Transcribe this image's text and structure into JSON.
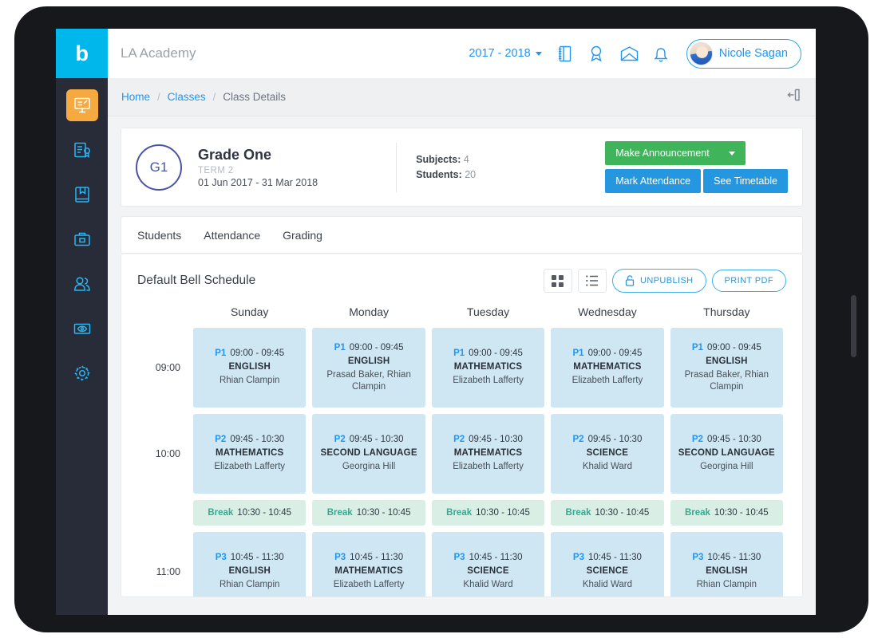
{
  "topbar": {
    "logo_letter": "b",
    "brand": "LA Academy",
    "year": "2017 - 2018",
    "icons": [
      "notebook-icon",
      "award-icon",
      "envelope-icon",
      "bell-icon"
    ],
    "user_name": "Nicole Sagan"
  },
  "sidebar": {
    "items": [
      {
        "icon": "whiteboard-icon",
        "active": true
      },
      {
        "icon": "certificate-icon",
        "active": false
      },
      {
        "icon": "book-icon",
        "active": false
      },
      {
        "icon": "briefcase-icon",
        "active": false
      },
      {
        "icon": "people-icon",
        "active": false
      },
      {
        "icon": "payment-icon",
        "active": false
      },
      {
        "icon": "gear-icon",
        "active": false
      }
    ]
  },
  "breadcrumb": {
    "home": "Home",
    "classes": "Classes",
    "current": "Class Details",
    "sep": "/",
    "logout_icon": "logout-icon"
  },
  "class_card": {
    "badge": "G1",
    "title": "Grade One",
    "term": "TERM 2",
    "dates": "01 Jun 2017 - 31 Mar 2018",
    "subjects_label": "Subjects:",
    "subjects_value": "4",
    "students_label": "Students:",
    "students_value": "20",
    "announce_button": "Make Announcement",
    "attendance_button": "Mark Attendance",
    "timetable_button": "See Timetable",
    "green": "#3fb45a",
    "blue": "#2596e0"
  },
  "tabs": [
    {
      "label": "Students"
    },
    {
      "label": "Attendance"
    },
    {
      "label": "Grading"
    }
  ],
  "schedule": {
    "title": "Default Bell Schedule",
    "grid_view_icon": "grid-view-icon",
    "list_view_icon": "list-view-icon",
    "unpublish_button": "UNPUBLISH",
    "unpublish_icon": "unlock-icon",
    "print_button": "PRINT PDF",
    "days": [
      "Sunday",
      "Monday",
      "Tuesday",
      "Wednesday",
      "Thursday"
    ],
    "time_labels": [
      "09:00",
      "10:00",
      "",
      "11:00"
    ],
    "rows": [
      {
        "type": "period",
        "slots": [
          {
            "period": "P1",
            "time": "09:00 - 09:45",
            "subject": "ENGLISH",
            "teachers": "Rhian Clampin"
          },
          {
            "period": "P1",
            "time": "09:00 - 09:45",
            "subject": "ENGLISH",
            "teachers": "Prasad Baker, Rhian Clampin"
          },
          {
            "period": "P1",
            "time": "09:00 - 09:45",
            "subject": "MATHEMATICS",
            "teachers": "Elizabeth Lafferty"
          },
          {
            "period": "P1",
            "time": "09:00 - 09:45",
            "subject": "MATHEMATICS",
            "teachers": "Elizabeth Lafferty"
          },
          {
            "period": "P1",
            "time": "09:00 - 09:45",
            "subject": "ENGLISH",
            "teachers": "Prasad Baker, Rhian Clampin"
          }
        ]
      },
      {
        "type": "period",
        "slots": [
          {
            "period": "P2",
            "time": "09:45 - 10:30",
            "subject": "MATHEMATICS",
            "teachers": "Elizabeth Lafferty"
          },
          {
            "period": "P2",
            "time": "09:45 - 10:30",
            "subject": "SECOND LANGUAGE",
            "teachers": "Georgina Hill"
          },
          {
            "period": "P2",
            "time": "09:45 - 10:30",
            "subject": "MATHEMATICS",
            "teachers": "Elizabeth Lafferty"
          },
          {
            "period": "P2",
            "time": "09:45 - 10:30",
            "subject": "SCIENCE",
            "teachers": "Khalid Ward"
          },
          {
            "period": "P2",
            "time": "09:45 - 10:30",
            "subject": "SECOND LANGUAGE",
            "teachers": "Georgina Hill"
          }
        ]
      },
      {
        "type": "break",
        "slots": [
          {
            "label": "Break",
            "time": "10:30 - 10:45"
          },
          {
            "label": "Break",
            "time": "10:30 - 10:45"
          },
          {
            "label": "Break",
            "time": "10:30 - 10:45"
          },
          {
            "label": "Break",
            "time": "10:30 - 10:45"
          },
          {
            "label": "Break",
            "time": "10:30 - 10:45"
          }
        ]
      },
      {
        "type": "period",
        "slots": [
          {
            "period": "P3",
            "time": "10:45 - 11:30",
            "subject": "ENGLISH",
            "teachers": "Rhian Clampin"
          },
          {
            "period": "P3",
            "time": "10:45 - 11:30",
            "subject": "MATHEMATICS",
            "teachers": "Elizabeth Lafferty"
          },
          {
            "period": "P3",
            "time": "10:45 - 11:30",
            "subject": "SCIENCE",
            "teachers": "Khalid Ward"
          },
          {
            "period": "P3",
            "time": "10:45 - 11:30",
            "subject": "SCIENCE",
            "teachers": "Khalid Ward"
          },
          {
            "period": "P3",
            "time": "10:45 - 11:30",
            "subject": "ENGLISH",
            "teachers": "Rhian Clampin"
          }
        ]
      }
    ]
  }
}
